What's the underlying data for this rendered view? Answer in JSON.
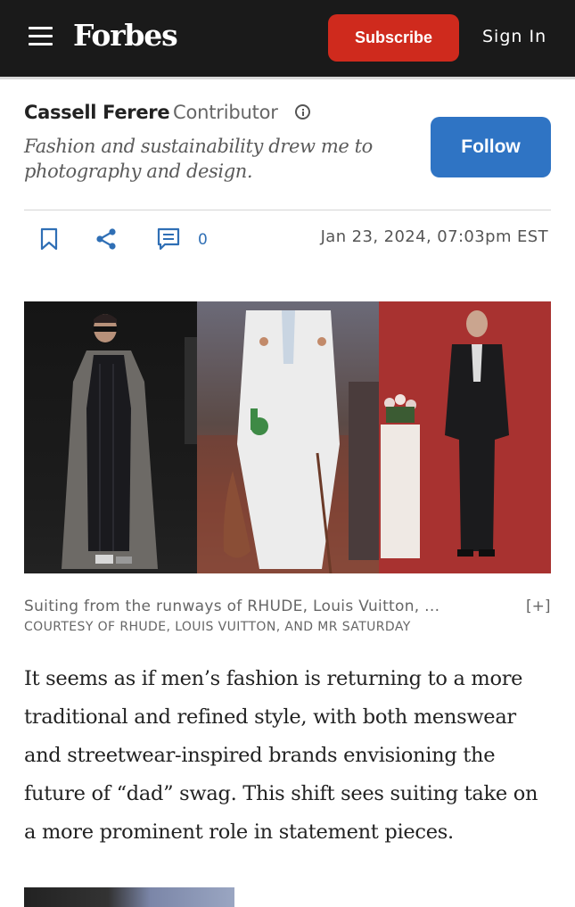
{
  "header": {
    "logo": "Forbes",
    "subscribe_label": "Subscribe",
    "signin_label": "Sign In",
    "background": "#1a1a1a",
    "subscribe_color": "#cf2a1d"
  },
  "author": {
    "name": "Cassell Ferere",
    "role": "Contributor",
    "bio": "Fashion and sustainability drew me to photography and design.",
    "follow_label": "Follow",
    "follow_color": "#2f74c4"
  },
  "toolbar": {
    "icons": [
      "bookmark-icon",
      "share-icon",
      "comment-icon"
    ],
    "comment_count": "0",
    "date": "Jan 23, 2024, 07:03pm EST"
  },
  "image": {
    "caption": "Suiting from the runways of RHUDE, Louis Vuitton, ...",
    "expand_label": "[+]",
    "credit": "COURTESY OF RHUDE, LOUIS VUITTON, AND MR SATURDAY"
  },
  "article": {
    "paragraph": "It seems as if men’s fashion is returning to a more traditional and refined style, with both menswear and streetwear-inspired brands envisioning the future of “dad” swag. This shift sees suiting take on a more prominent role in statement pieces."
  }
}
